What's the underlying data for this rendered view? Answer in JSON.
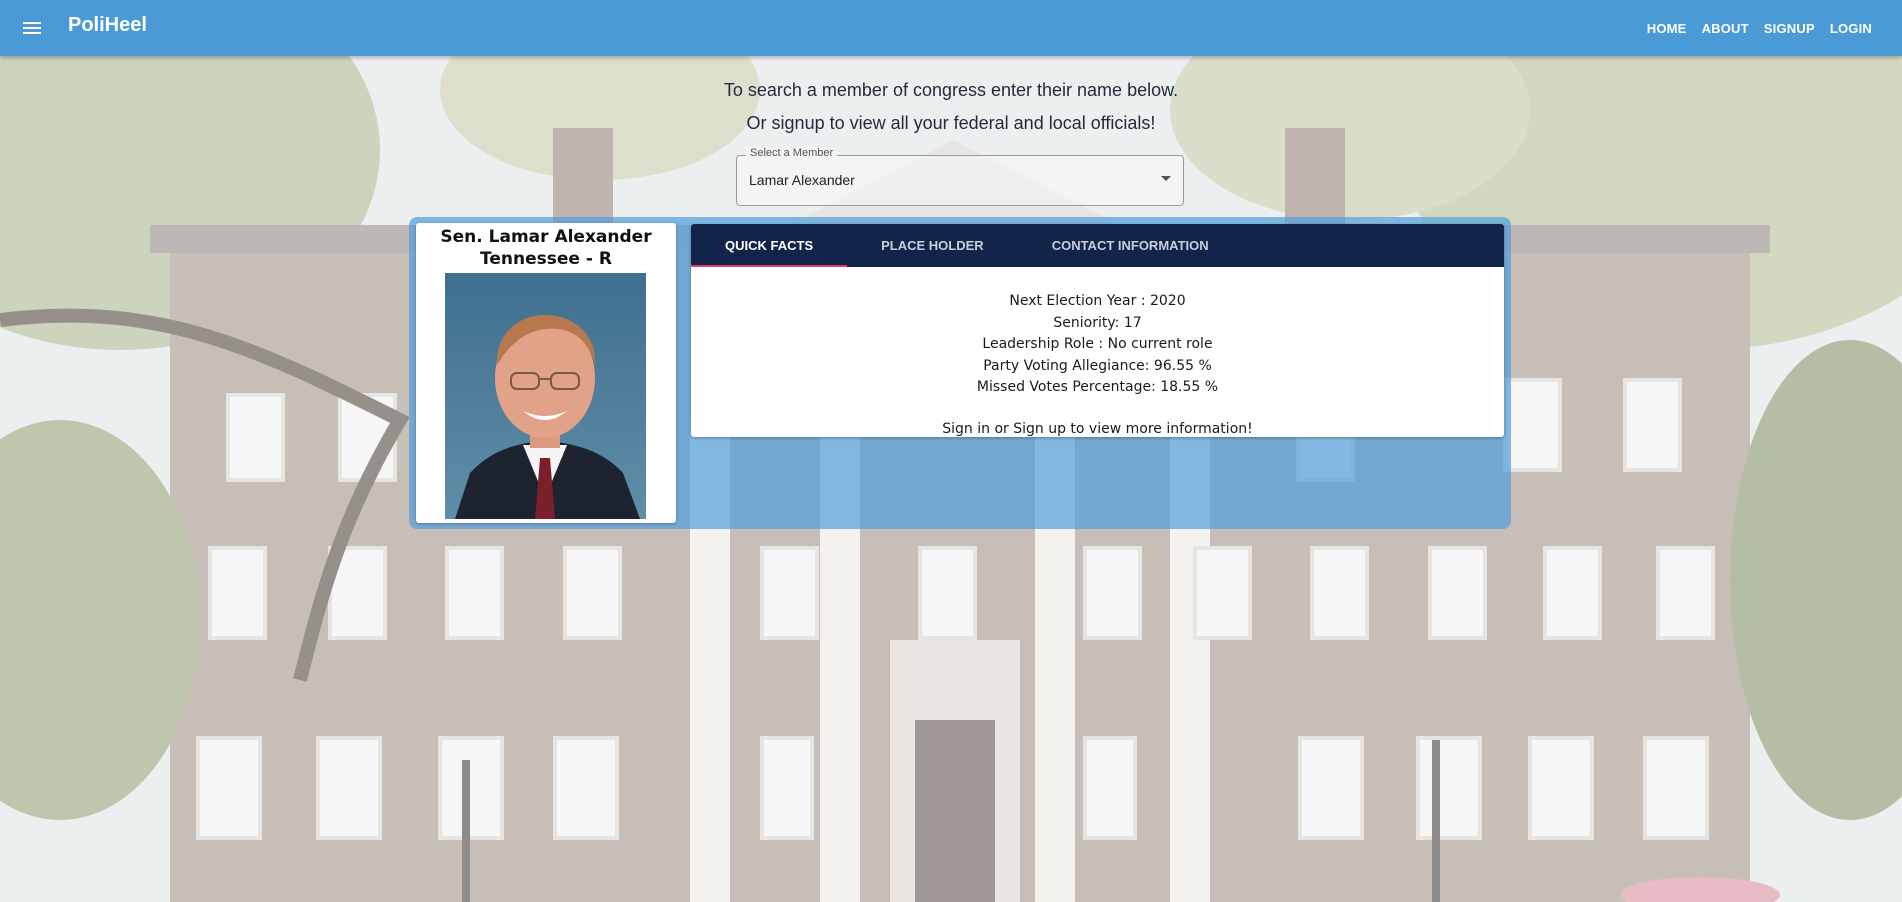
{
  "app": {
    "title": "PoliHeel",
    "menu_icon": "hamburger-menu-icon",
    "bar_color": "#4a9ad5"
  },
  "nav": {
    "items": [
      {
        "label": "HOME"
      },
      {
        "label": "ABOUT"
      },
      {
        "label": "SIGNUP"
      },
      {
        "label": "LOGIN"
      }
    ]
  },
  "intro": {
    "line1": "To search a member of congress enter their name below.",
    "line2": "Or signup to view all your federal and local officials!"
  },
  "member_select": {
    "label": "Select a Member",
    "value": "Lamar Alexander",
    "arrow_icon": "dropdown-arrow-icon"
  },
  "profile": {
    "name": "Sen. Lamar Alexander",
    "state_party": "Tennessee - R",
    "photo": "senator-portrait"
  },
  "tabs": [
    {
      "label": "QUICK FACTS",
      "active": true
    },
    {
      "label": "PLACE HOLDER",
      "active": false
    },
    {
      "label": "CONTACT INFORMATION",
      "active": false
    }
  ],
  "quick_facts": {
    "next_election": "Next Election Year : 2020",
    "seniority": "Seniority: 17",
    "leadership": "Leadership Role : No current role",
    "party_allegiance": "Party Voting Allegiance: 96.55 %",
    "missed_votes": "Missed Votes Percentage: 18.55 %",
    "cta": "Sign in or Sign up to view more information!"
  },
  "colors": {
    "panel": "#54a0db",
    "tab_bar": "#13244a",
    "tab_indicator": "#e63a6e"
  }
}
